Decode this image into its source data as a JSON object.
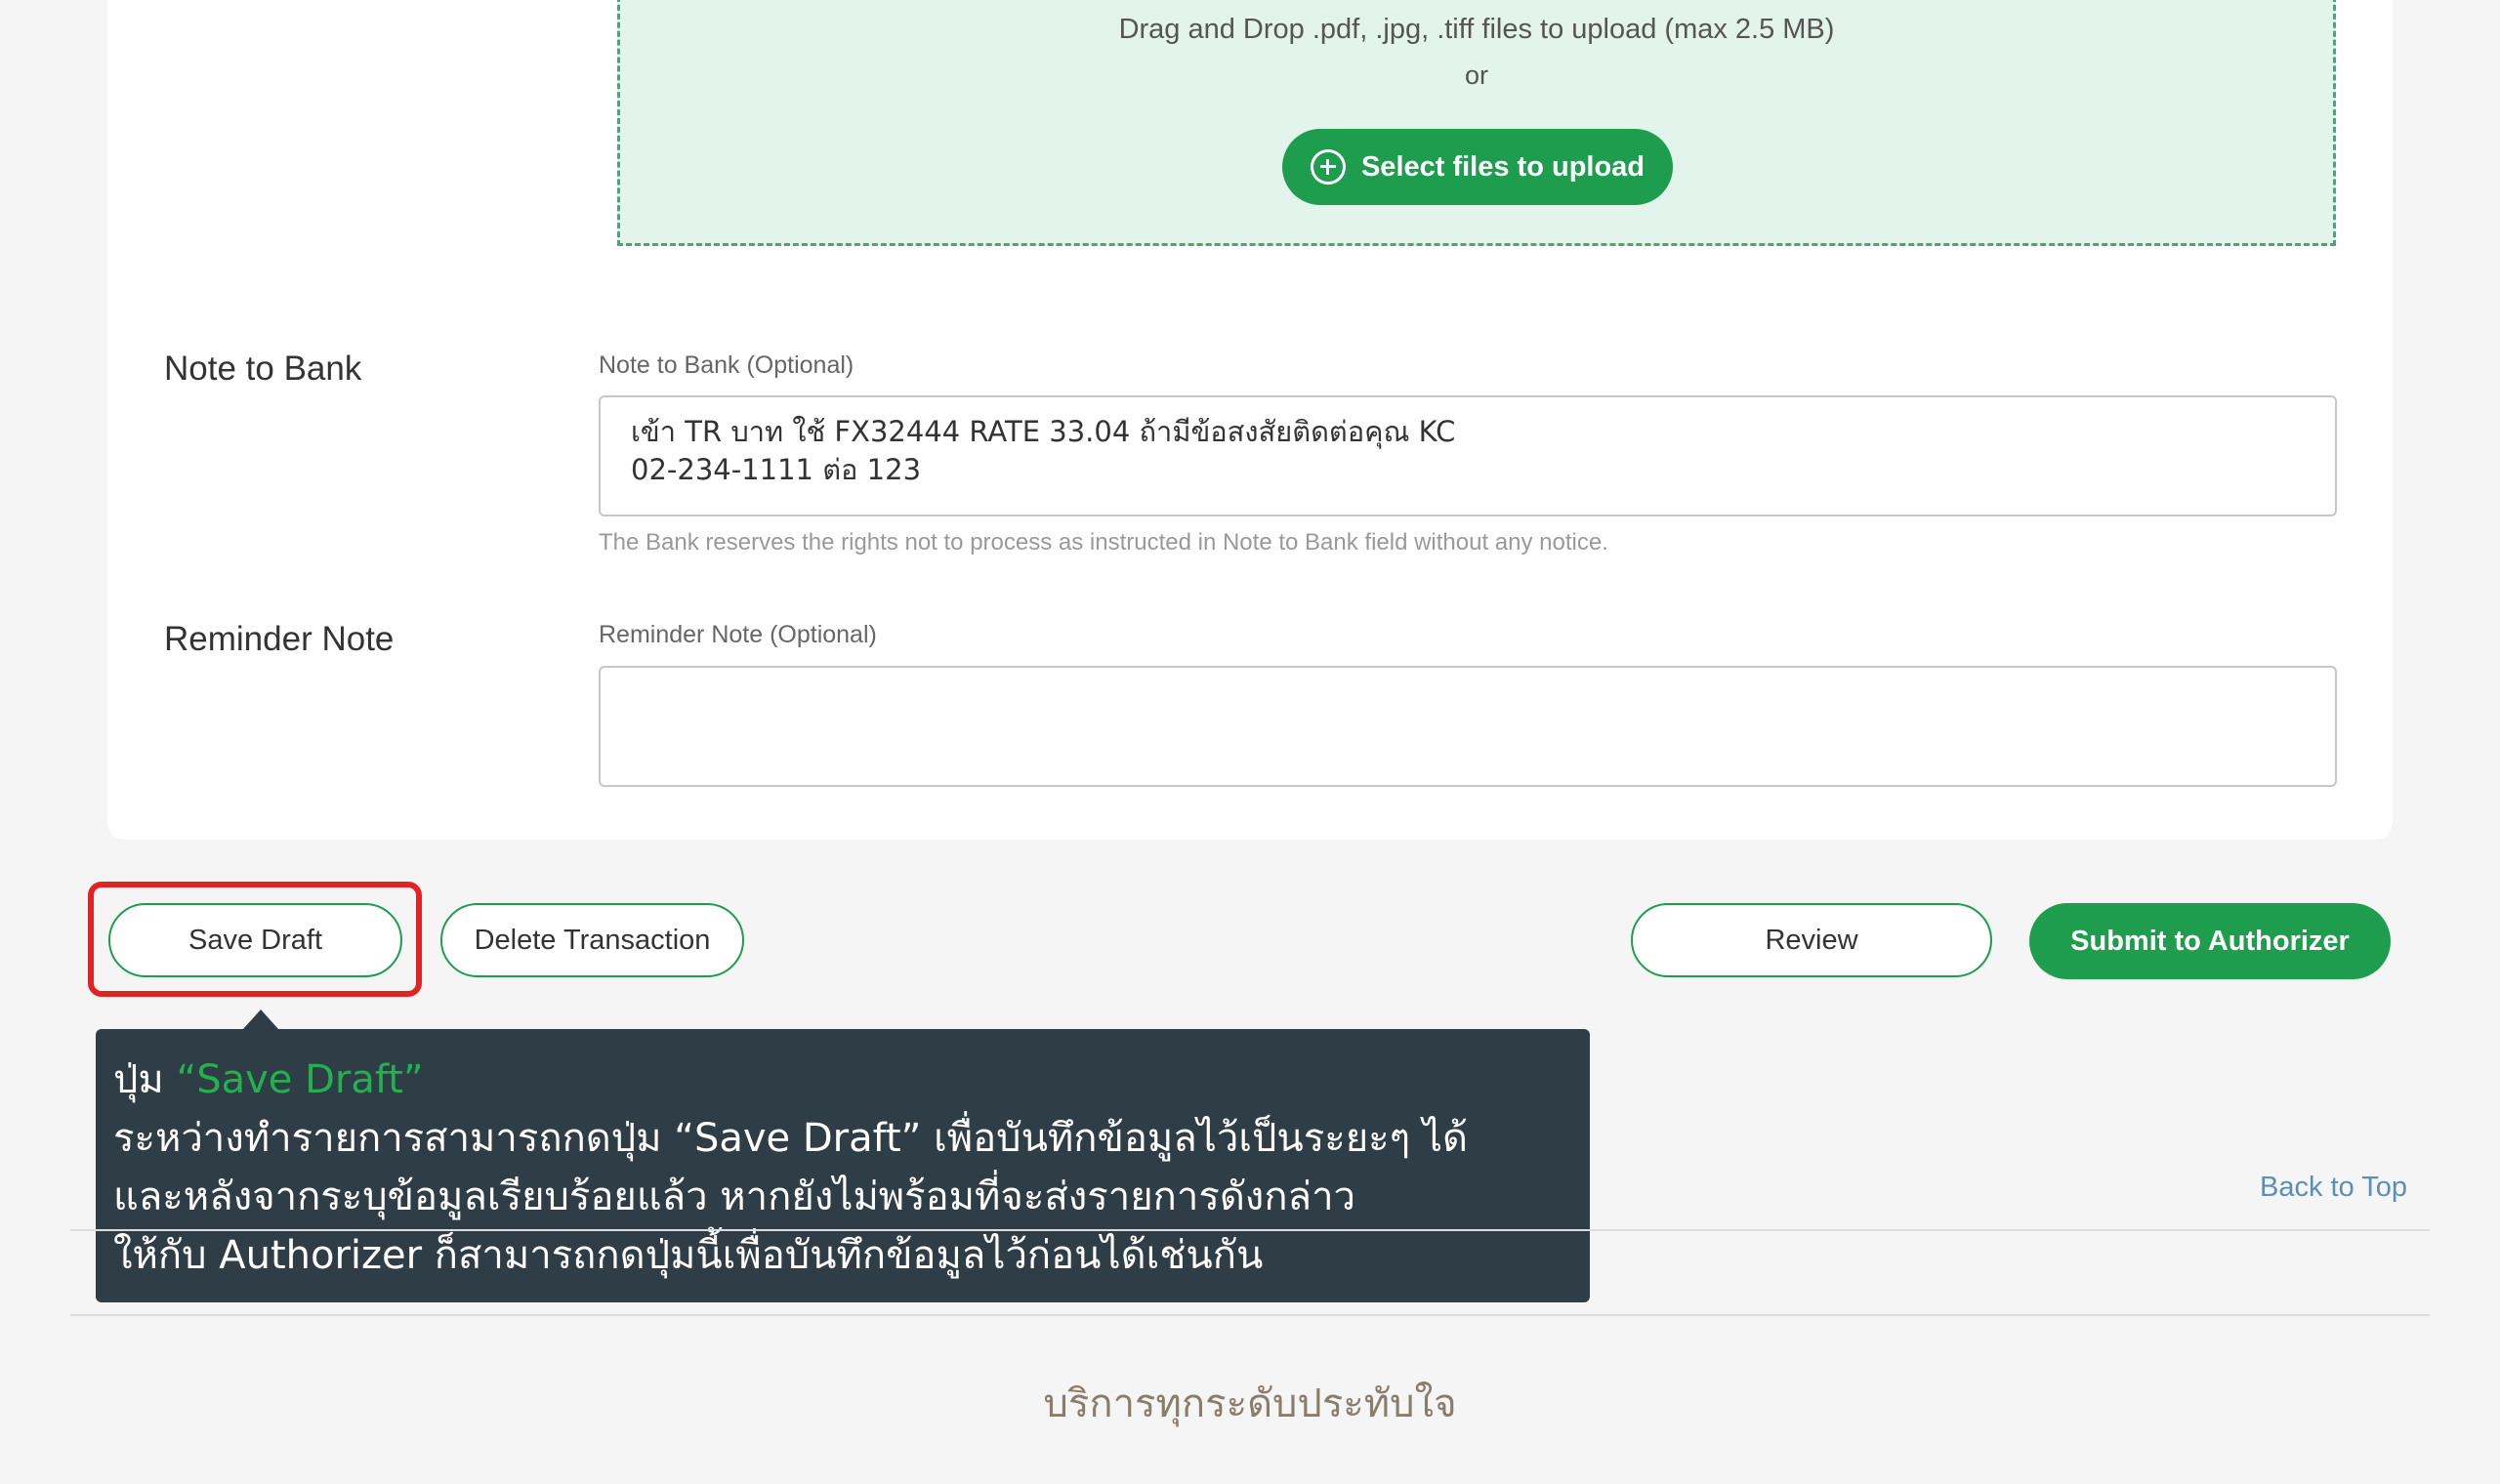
{
  "upload": {
    "instruction": "Drag and Drop .pdf, .jpg, .tiff files to upload (max 2.5 MB)",
    "or": "or",
    "button_label": "Select files to upload",
    "button_icon": "plus-circle-icon"
  },
  "note_to_bank": {
    "section_label": "Note to Bank",
    "field_label": "Note to Bank (Optional)",
    "value": "เข้า TR บาท ใช้ FX32444 RATE 33.04 ถ้ามีข้อสงสัยติดต่อคุณ KC\n02-234-1111 ต่อ 123",
    "hint": "The Bank reserves the rights not to process as instructed in Note to Bank field without any notice."
  },
  "reminder_note": {
    "section_label": "Reminder Note",
    "field_label": "Reminder Note (Optional)",
    "value": ""
  },
  "actions": {
    "save_draft": "Save Draft",
    "delete_transaction": "Delete Transaction",
    "review": "Review",
    "submit": "Submit to Authorizer"
  },
  "tooltip": {
    "prefix": "ปุ่ม ",
    "highlight": "“Save Draft”",
    "line2": "ระหว่างทำรายการสามารถกดปุ่ม “Save Draft” เพื่อบันทึกข้อมูลไว้เป็นระยะๆ ได้",
    "line3": "และหลังจากระบุข้อมูลเรียบร้อยแล้ว หากยังไม่พร้อมที่จะส่งรายการดังกล่าว",
    "line4": "ให้กับ Authorizer ก็สามารถกดปุ่มนี้เพื่อบันทึกข้อมูลไว้ก่อนได้เช่นกัน"
  },
  "footer": {
    "back_to_top": "Back to Top",
    "slogan": "บริการทุกระดับประทับใจ"
  },
  "colors": {
    "accent": "#1e9d4f",
    "highlight_border": "#e02424",
    "tooltip_bg": "#2f3e46",
    "tooltip_accent": "#22b14c",
    "link": "#5b8fb5"
  }
}
